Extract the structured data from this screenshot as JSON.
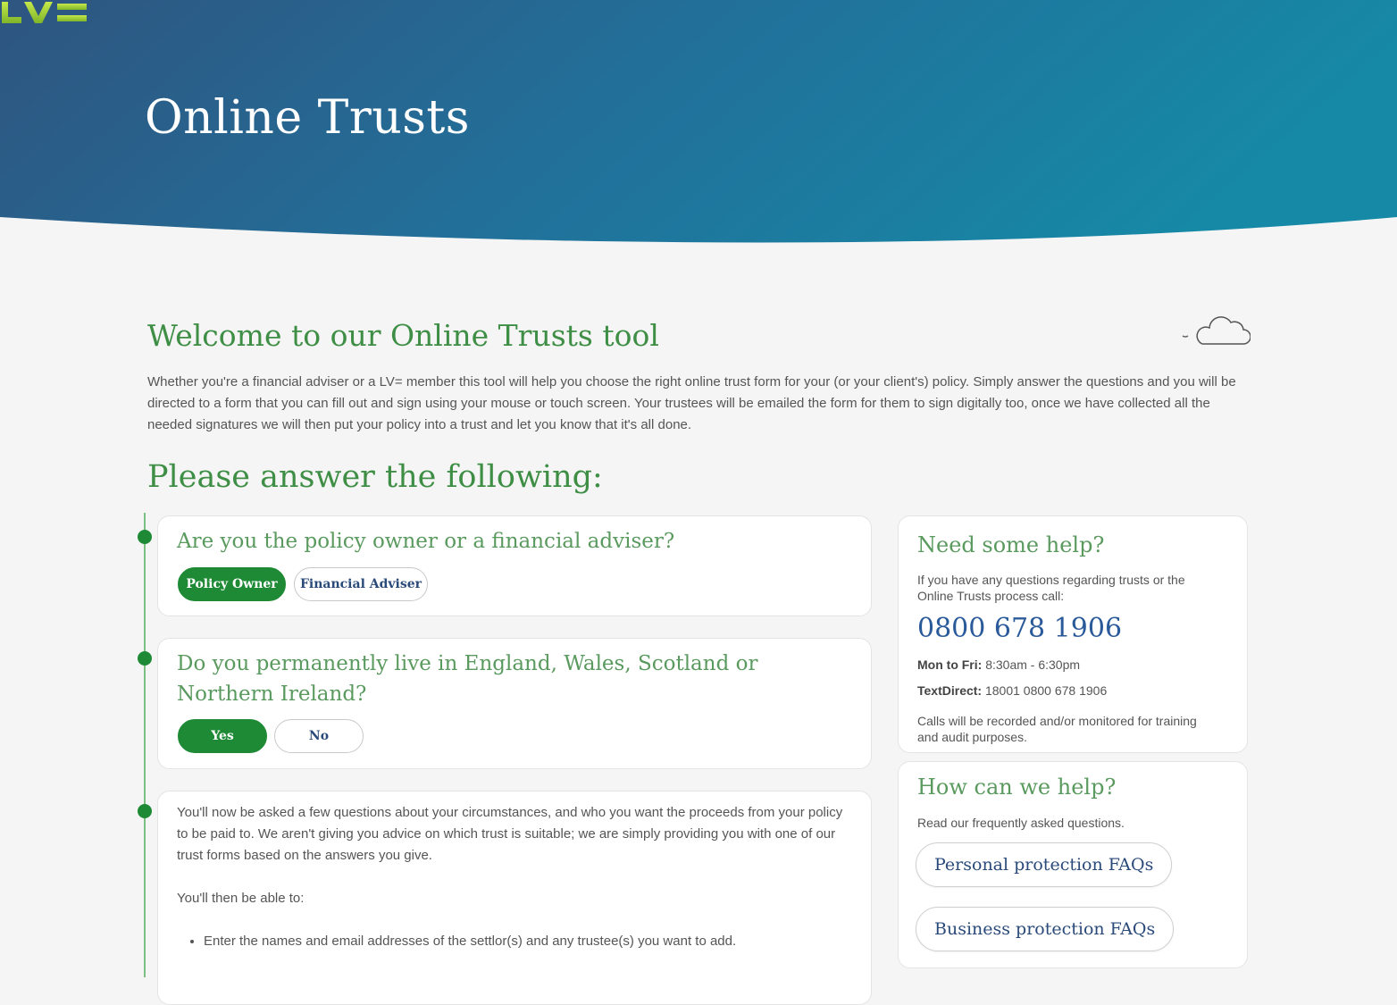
{
  "brand": {
    "logo_text": "LV=",
    "primary_color": "#2a5a8a",
    "accent_green": "#1e8a35",
    "logo_green": "#9acd32"
  },
  "hero": {
    "title": "Online Trusts"
  },
  "welcome": {
    "title": "Welcome to our Online Trusts tool",
    "intro": "Whether you're a financial adviser or a LV= member this tool will help you choose the right online trust form for your (or your client's) policy. Simply answer the questions and you will be directed to a form that you can fill out and sign using your mouse or touch screen. Your trustees will be emailed the form for them to sign digitally too, once we have collected all the needed signatures we will then put your policy into a trust and let you know that it's all done.",
    "icon": "cloud-icon"
  },
  "questions": {
    "heading": "Please answer the following:",
    "q1": {
      "title": "Are you the policy owner or a financial adviser?",
      "options": [
        "Policy Owner",
        "Financial Adviser"
      ],
      "selected": "Policy Owner"
    },
    "q2": {
      "title": "Do you permanently live in England, Wales, Scotland or Northern Ireland?",
      "options": [
        "Yes",
        "No"
      ],
      "selected": "Yes"
    },
    "info": {
      "p1": "You'll now be asked a few questions about your circumstances, and who you want the proceeds from your policy to be paid to. We aren't giving you advice on which trust is suitable; we are simply providing you with one of our trust forms based on the answers you give.",
      "p2": "You'll then be able to:",
      "bullets": [
        "Enter the names and email addresses of the settlor(s) and any trustee(s) you want to add."
      ]
    }
  },
  "help": {
    "title": "Need some help?",
    "intro": "If you have any questions regarding trusts or the Online Trusts process call:",
    "phone": "0800 678 1906",
    "hours_label": "Mon to Fri:",
    "hours_value": "8:30am - 6:30pm",
    "textdirect_label": "TextDirect:",
    "textdirect_value": "18001 0800 678 1906",
    "note": "Calls will be recorded and/or monitored for training and audit purposes."
  },
  "faq": {
    "title": "How can we help?",
    "intro": "Read our frequently asked questions.",
    "links": [
      "Personal protection FAQs",
      "Business protection FAQs"
    ]
  }
}
